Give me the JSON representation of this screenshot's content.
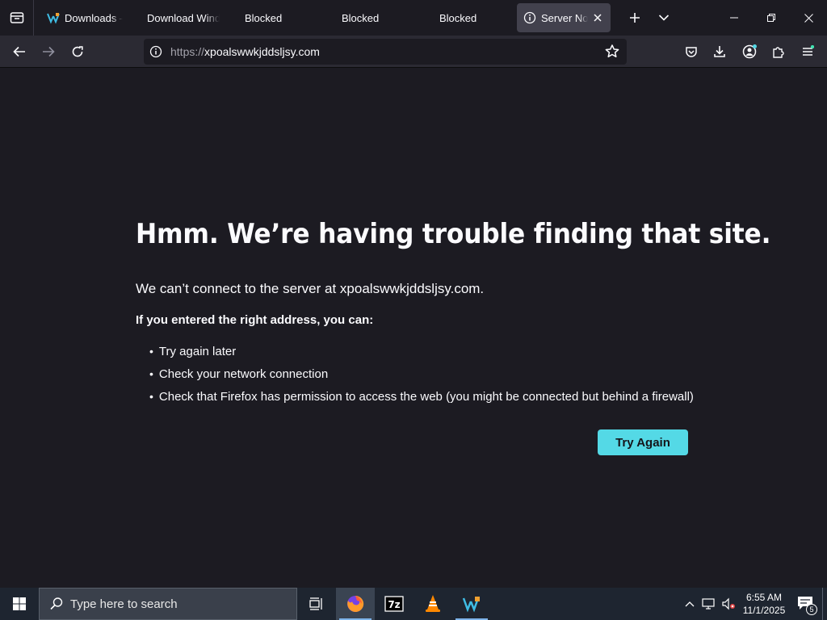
{
  "browser": {
    "tabs": [
      {
        "label": "Downloads – O",
        "icon": "veeam-icon",
        "active": false
      },
      {
        "label": "Download Window",
        "icon": "none",
        "active": false
      },
      {
        "label": "Blocked",
        "icon": "none",
        "active": false
      },
      {
        "label": "Blocked",
        "icon": "dot",
        "active": false
      },
      {
        "label": "Blocked",
        "icon": "dot",
        "active": false
      },
      {
        "label": "Server Not Found",
        "icon": "info-icon",
        "active": true
      }
    ],
    "url_scheme": "https://",
    "url_host": "xpoalswwkjddsljsy.com"
  },
  "error_page": {
    "title": "Hmm. We’re having trouble finding that site.",
    "description": "We can’t connect to the server at xpoalswwkjddsljsy.com.",
    "subhead": "If you entered the right address, you can:",
    "bullets": [
      "Try again later",
      "Check your network connection",
      "Check that Firefox has permission to access the web (you might be connected but behind a firewall)"
    ],
    "try_again_label": "Try Again"
  },
  "taskbar": {
    "search_placeholder": "Type here to search",
    "time": "6:55 AM",
    "date": "11/1/2025",
    "notification_count": "5"
  },
  "colors": {
    "page_bg": "#1c1b22",
    "toolbar_bg": "#2b2a33",
    "button_accent": "#54d9e6",
    "taskbar_bg": "#1e2530"
  }
}
